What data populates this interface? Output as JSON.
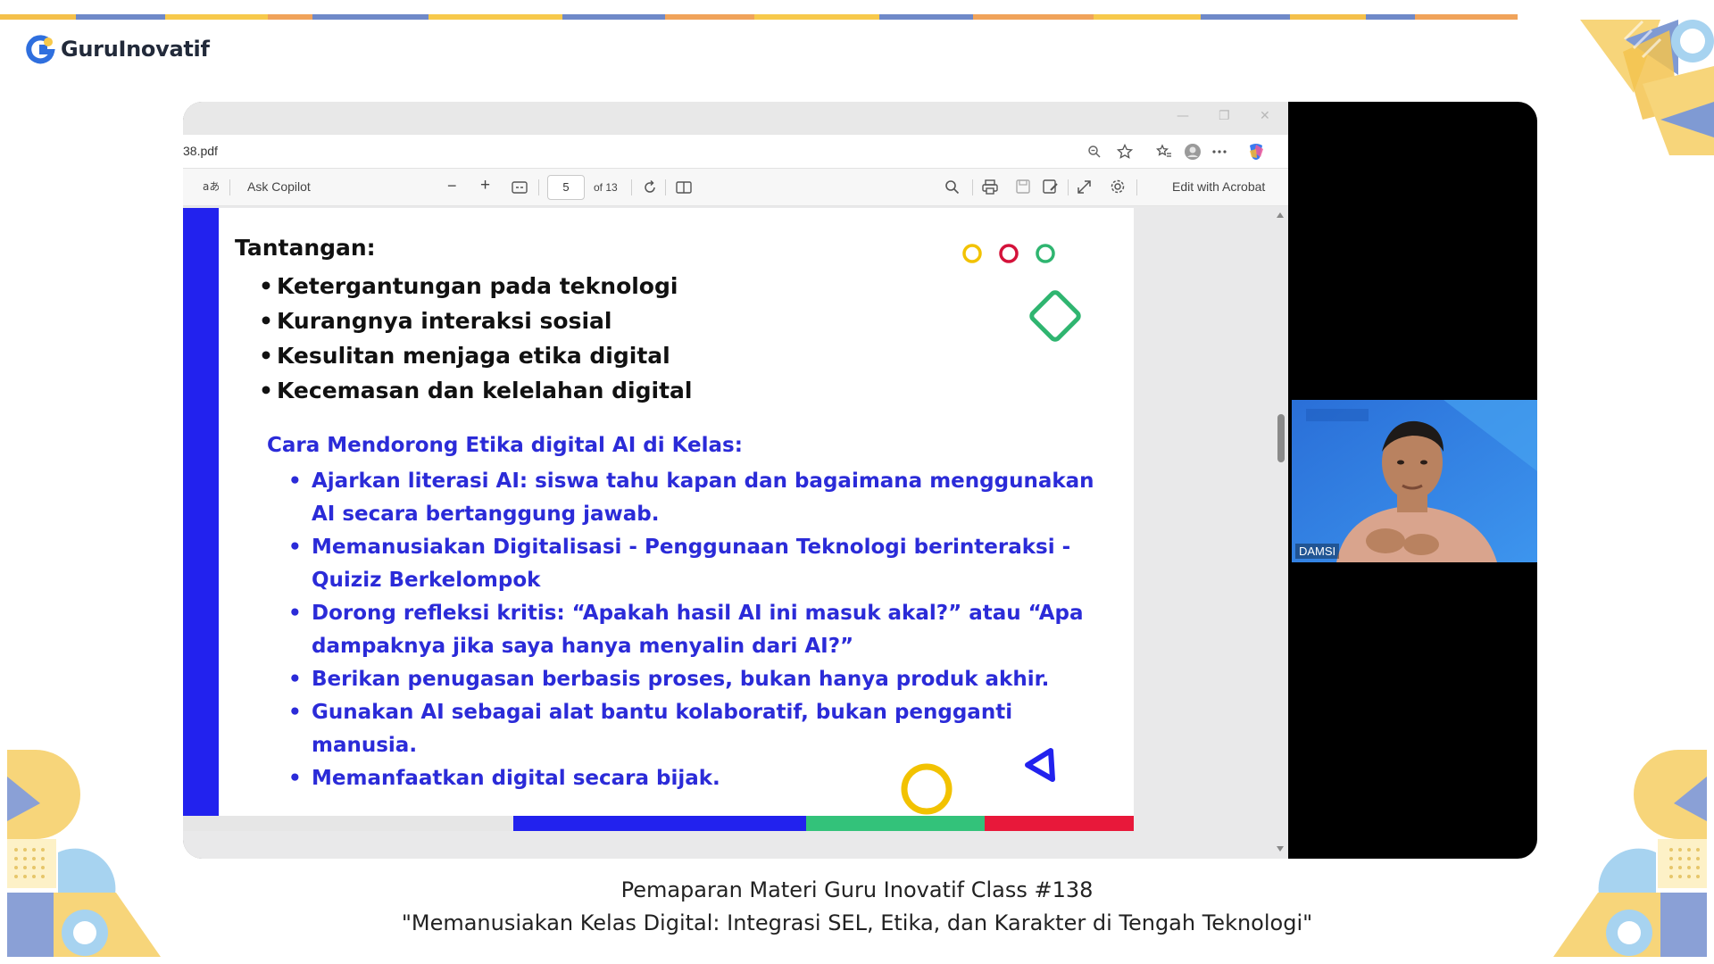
{
  "brand": {
    "name": "GuruInovatif"
  },
  "colors": {
    "brand_blue": "#2f6fde",
    "brand_yellow": "#f7c94b",
    "slide_blue": "#2222ee",
    "slide_text_blue": "#2b2bd8",
    "bar_green": "#33c27a",
    "bar_red": "#e8183a"
  },
  "browser": {
    "url": "38.pdf",
    "toolbar": {
      "read_aloud_icon": "read-aloud-icon",
      "ask_copilot": "Ask Copilot",
      "zoom_out": "−",
      "zoom_in": "+",
      "page_current": "5",
      "page_total": "of 13",
      "edit_with_acrobat": "Edit with Acrobat"
    }
  },
  "slide": {
    "tantangan_title": "Tantangan:",
    "tantangan_items": [
      "Ketergantungan pada teknologi",
      "Kurangnya interaksi sosial",
      "Kesulitan menjaga etika digital",
      "Kecemasan dan kelelahan digital"
    ],
    "cara_title": "Cara Mendorong Etika digital AI di Kelas:",
    "cara_items": [
      "Ajarkan literasi AI: siswa tahu kapan dan bagaimana menggunakan AI secara bertanggung jawab.",
      "Memanusiakan Digitalisasi - Penggunaan Teknologi berinteraksi - Quiziz Berkelompok",
      "Dorong refleksi kritis: “Apakah hasil AI ini masuk akal?” atau “Apa dampaknya jika saya hanya menyalin dari AI?”",
      "Berikan penugasan berbasis proses, bukan hanya produk akhir.",
      "Gunakan AI sebagai alat bantu kolaboratif, bukan pengganti manusia.",
      "Memanfaatkan  digital secara bijak."
    ]
  },
  "webcam": {
    "name_tag": "DAMSI"
  },
  "caption": {
    "line1": "Pemaparan Materi Guru Inovatif Class #138",
    "line2": "\"Memanusiakan Kelas Digital: Integrasi SEL, Etika, dan Karakter di Tengah Teknologi\""
  }
}
